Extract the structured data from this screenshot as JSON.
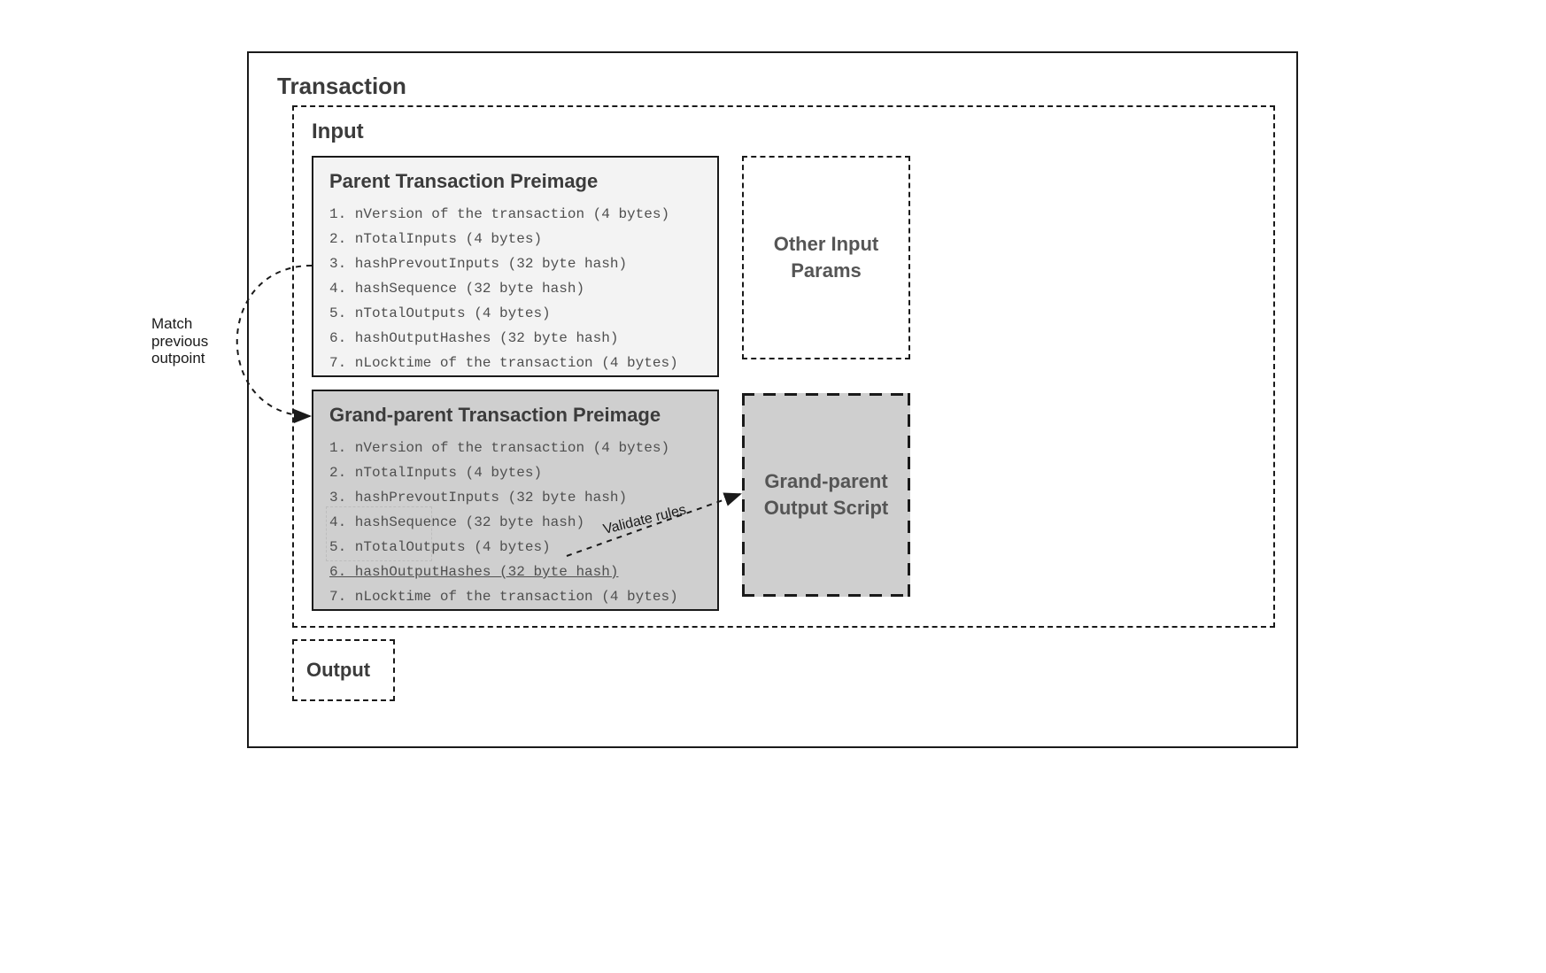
{
  "transaction": {
    "title": "Transaction",
    "input": {
      "title": "Input",
      "parent_preimage": {
        "title": "Parent Transaction Preimage",
        "items": [
          "1. nVersion of the transaction (4 bytes)",
          "2. nTotalInputs (4 bytes)",
          "3. hashPrevoutInputs (32 byte hash)",
          "4. hashSequence (32 byte hash)",
          "5. nTotalOutputs (4 bytes)",
          "6. hashOutputHashes (32 byte hash)",
          "7. nLocktime of the transaction (4 bytes)"
        ]
      },
      "grandparent_preimage": {
        "title": "Grand-parent Transaction Preimage",
        "items": [
          "1. nVersion of the transaction (4 bytes)",
          "2. nTotalInputs (4 bytes)",
          "3. hashPrevoutInputs (32 byte hash)",
          "4. hashSequence (32 byte hash)",
          "5. nTotalOutputs (4 bytes)",
          "6. hashOutputHashes (32 byte hash)",
          "7. nLocktime of the transaction (4 bytes)"
        ]
      },
      "other_params": {
        "label": "Other Input\nParams"
      },
      "grandparent_output_script": {
        "label": "Grand-parent\nOutput Script"
      }
    },
    "output": {
      "title": "Output"
    }
  },
  "annotations": {
    "match_outpoint": "Match\nprevious\noutpoint",
    "validate_rules": "Validate rules"
  }
}
